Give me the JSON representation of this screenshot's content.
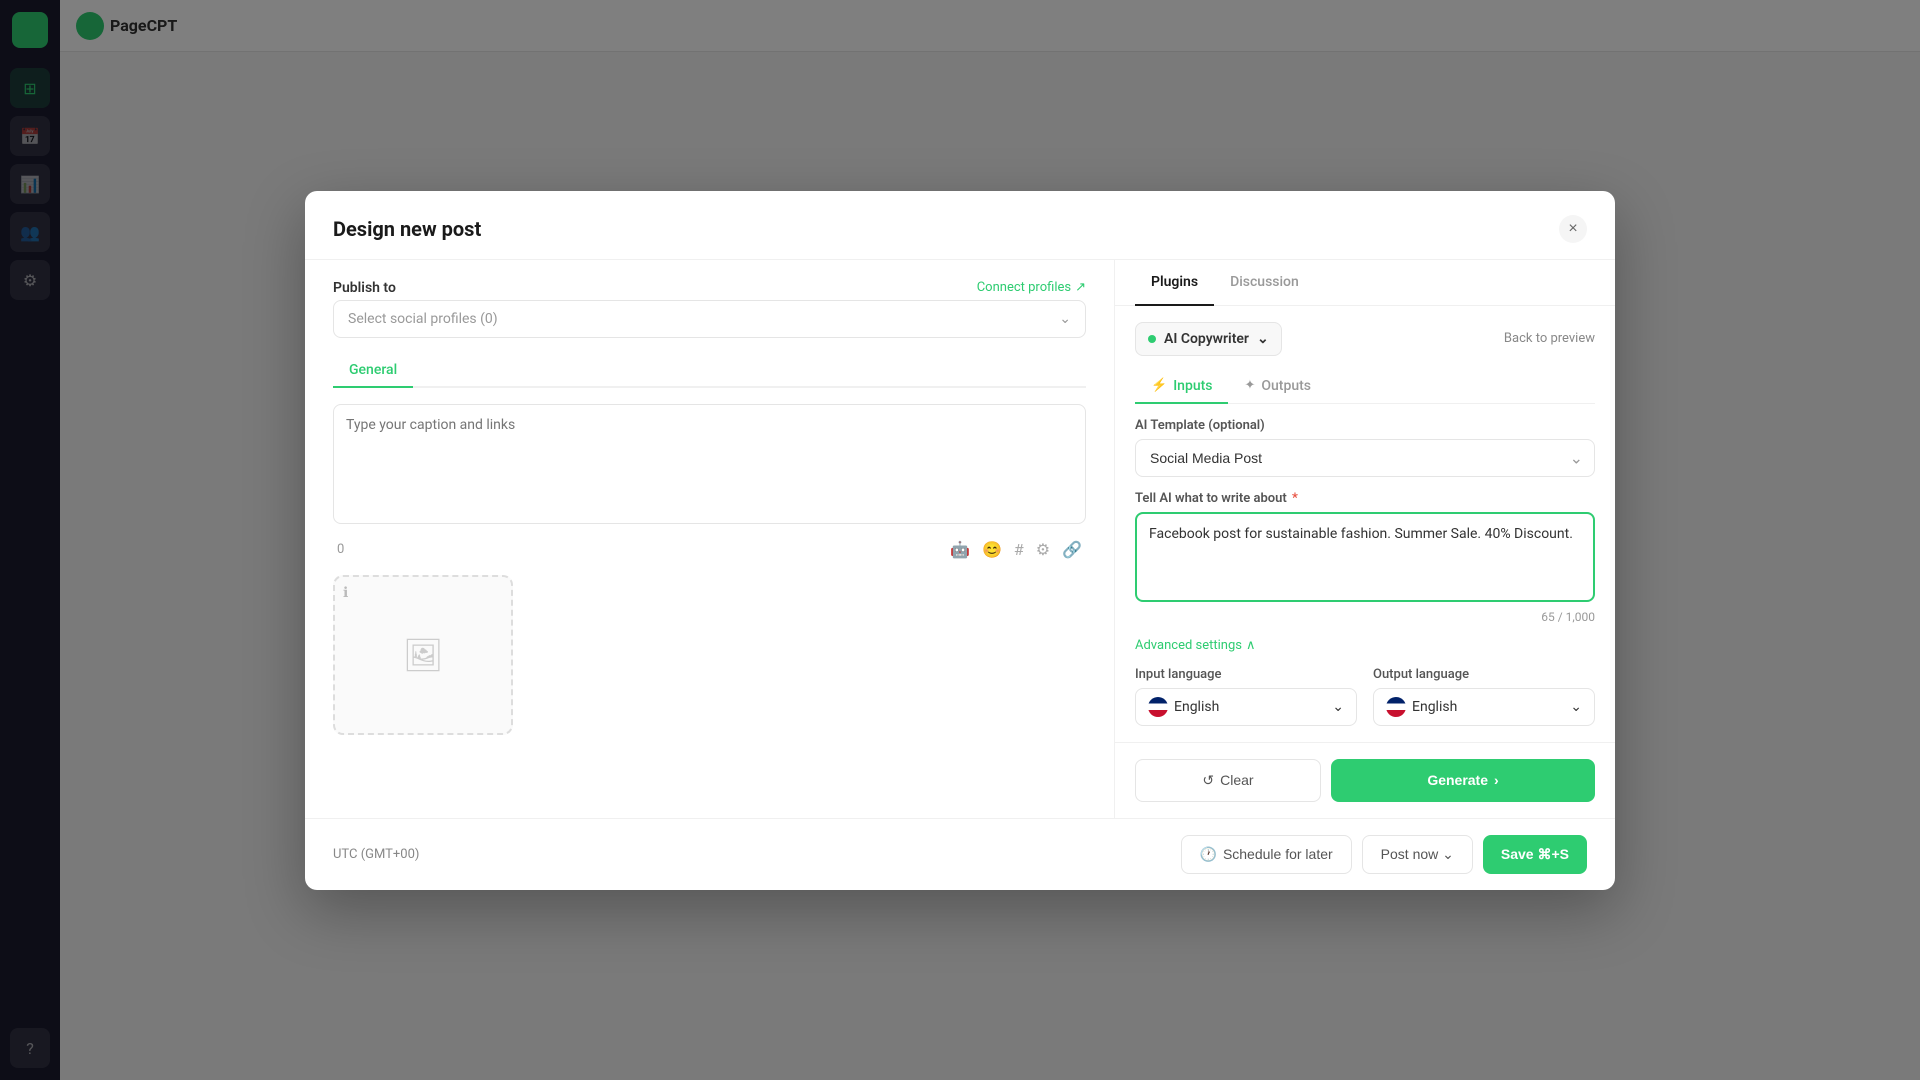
{
  "modal": {
    "title": "Design new post",
    "close_label": "×"
  },
  "left_panel": {
    "publish_to_label": "Publish to",
    "connect_profiles_label": "Connect profiles",
    "profiles_placeholder": "Select social profiles (0)",
    "tab_general": "General",
    "caption_placeholder": "Type your caption and links",
    "char_count": "0",
    "media_info_icon": "ℹ",
    "media_placeholder_icon": "🖼"
  },
  "right_panel": {
    "tab_plugins": "Plugins",
    "tab_discussion": "Discussion",
    "plugin_name": "AI Copywriter",
    "back_to_preview": "Back to preview",
    "tab_inputs": "Inputs",
    "tab_outputs": "Outputs",
    "inputs_icon": "⚡",
    "outputs_icon": "✦",
    "ai_template_label": "AI Template (optional)",
    "ai_template_value": "Social Media Post",
    "write_about_label": "Tell AI what to write about",
    "write_about_required": "*",
    "write_about_value": "Facebook post for sustainable fashion. Summer Sale. 40% Discount.",
    "write_about_char_count": "65 / 1,000",
    "advanced_settings_label": "Advanced settings",
    "input_language_label": "Input language",
    "output_language_label": "Output language",
    "input_language_value": "English",
    "output_language_value": "English",
    "clear_label": "Clear",
    "generate_label": "Generate",
    "generate_icon": "→"
  },
  "footer": {
    "timezone": "UTC (GMT+00)",
    "schedule_label": "Schedule for later",
    "post_now_label": "Post now",
    "save_label": "Save ⌘+S"
  }
}
